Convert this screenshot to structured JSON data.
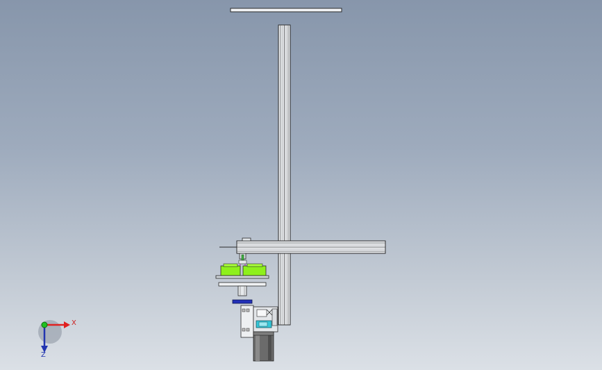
{
  "viewport": {
    "background_top": "#8796ab",
    "background_bottom": "#dbe0e6"
  },
  "model": {
    "parts": [
      "top-plate",
      "vertical-aluminum-profile",
      "horizontal-aluminum-profile",
      "gripper-assembly",
      "green-fixtures",
      "base-plate",
      "blue-spacer",
      "servo-motor-assembly",
      "motor-body"
    ],
    "colors": {
      "profile": "#e8ebee",
      "outline": "#2a2a2a",
      "fixture_green": "#8ef01c",
      "spacer_blue": "#2230b8",
      "cyan_part": "#34c7d8",
      "motor_dark": "#6b6b6b"
    }
  },
  "triad": {
    "x_label": "X",
    "z_label": "Z",
    "x_color": "#e02020",
    "y_color": "#20c020",
    "z_color": "#2235b0"
  }
}
